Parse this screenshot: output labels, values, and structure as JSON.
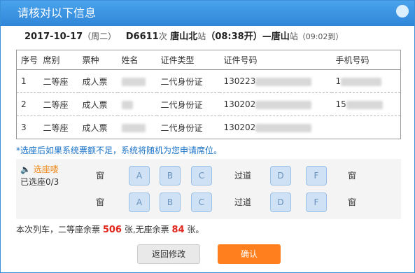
{
  "dialog": {
    "title": "请核对以下信息"
  },
  "trip": {
    "date": "2017-10-17",
    "weekday": "（周二）",
    "train": "D6611",
    "train_suffix": "次",
    "from": "唐山北",
    "from_suffix": "站",
    "depart_time": "（08:38开）",
    "dash": "—",
    "to": "唐山",
    "to_suffix": "站",
    "arrive_time": "（09:02到）"
  },
  "table": {
    "headers": [
      "序号",
      "席别",
      "票种",
      "姓名",
      "证件类型",
      "证件号码",
      "手机号码"
    ],
    "rows": [
      {
        "no": "1",
        "seat": "二等座",
        "ticket": "成人票",
        "id_type": "二代身份证",
        "id_no": "130223",
        "phone": "1"
      },
      {
        "no": "2",
        "seat": "二等座",
        "ticket": "成人票",
        "id_type": "二代身份证",
        "id_no": "130202",
        "phone": "15"
      },
      {
        "no": "3",
        "seat": "二等座",
        "ticket": "成人票",
        "id_type": "二代身份证",
        "id_no": "130202",
        "phone": ""
      }
    ]
  },
  "note": "*选座后如果系统票额不足，系统将随机为您申请席位。",
  "seat_select": {
    "title": "选座喽",
    "chosen": "已选座0/3",
    "window": "窗",
    "aisle": "过道",
    "seats_left": [
      "A",
      "B",
      "C"
    ],
    "seats_right": [
      "D",
      "F"
    ]
  },
  "remain": {
    "prefix": "本次列车，二等座余票",
    "second": "506",
    "mid": "张,无座余票",
    "none": "84",
    "suffix": "张。"
  },
  "buttons": {
    "back": "返回修改",
    "ok": "确认"
  }
}
